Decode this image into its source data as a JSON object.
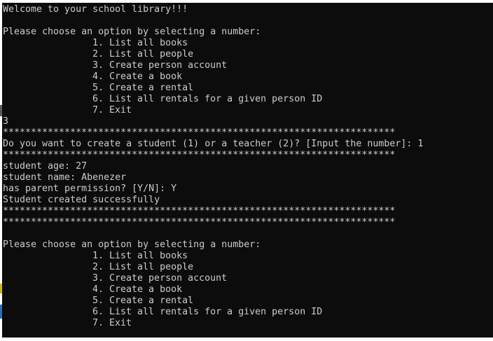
{
  "console": {
    "welcome": "Welcome to your school library!!!",
    "prompt": "Please choose an option by selecting a number:",
    "menu": [
      "1. List all books",
      "2. List all people",
      "3. Create person account",
      "4. Create a book",
      "5. Create a rental",
      "6. List all rentals for a given person ID",
      "7. Exit"
    ],
    "user_choice": "3",
    "separator": "**********************************************************************",
    "create_question": "Do you want to create a student (1) or a teacher (2)? [Input the number]: 1",
    "student_age": "student age: 27",
    "student_name": "student name: Abenezer",
    "parent_permission": "has parent permission? [Y/N]: Y",
    "success_message": "Student created successfully",
    "blank": ""
  },
  "colors": {
    "background": "#0c0c0c",
    "foreground": "#cccccc"
  }
}
